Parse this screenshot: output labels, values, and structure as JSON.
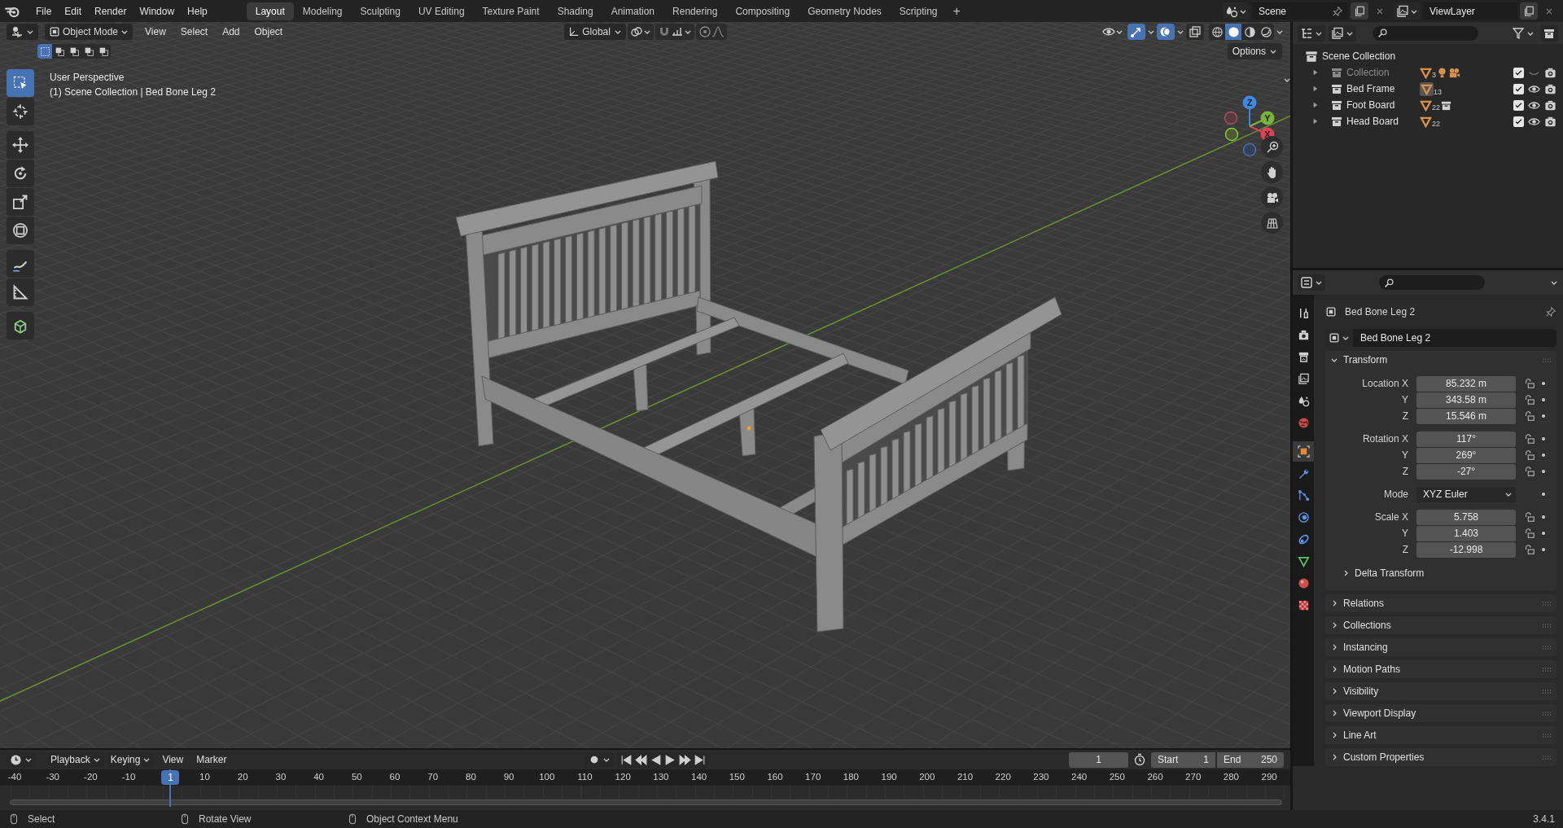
{
  "menu": [
    "File",
    "Edit",
    "Render",
    "Window",
    "Help"
  ],
  "workspaces": [
    {
      "label": "Layout",
      "selected": true
    },
    {
      "label": "Modeling",
      "selected": false
    },
    {
      "label": "Sculpting",
      "selected": false
    },
    {
      "label": "UV Editing",
      "selected": false
    },
    {
      "label": "Texture Paint",
      "selected": false
    },
    {
      "label": "Shading",
      "selected": false
    },
    {
      "label": "Animation",
      "selected": false
    },
    {
      "label": "Rendering",
      "selected": false
    },
    {
      "label": "Compositing",
      "selected": false
    },
    {
      "label": "Geometry Nodes",
      "selected": false
    },
    {
      "label": "Scripting",
      "selected": false
    }
  ],
  "add_workspace": "+",
  "scene": "Scene",
  "view_layer": "ViewLayer",
  "viewport": {
    "mode": "Object Mode",
    "menus": [
      "View",
      "Select",
      "Add",
      "Object"
    ],
    "orientation": "Global",
    "shading": [
      {
        "kind": "wireframe",
        "selected": false
      },
      {
        "kind": "solid",
        "selected": true
      },
      {
        "kind": "material",
        "selected": false
      },
      {
        "kind": "rendered",
        "selected": false
      }
    ],
    "options": "Options",
    "view_name": "User Perspective",
    "context": "(1) Scene Collection | Bed Bone Leg 2",
    "tools": [
      {
        "kind": "select",
        "selected": true
      },
      {
        "kind": "cursor",
        "selected": false
      },
      {
        "kind": "move",
        "selected": false
      },
      {
        "kind": "rotate",
        "selected": false
      },
      {
        "kind": "scale",
        "selected": false
      },
      {
        "kind": "transform",
        "selected": false
      },
      {
        "kind": "annotate",
        "selected": false
      },
      {
        "kind": "measure",
        "selected": false
      },
      {
        "kind": "add-cube",
        "selected": false
      }
    ],
    "axes": [
      "X",
      "Y",
      "Z"
    ]
  },
  "outliner": {
    "root": "Scene Collection",
    "items": [
      {
        "name": "Collection",
        "count": "3",
        "contents": [
          {
            "kind": "light"
          },
          {
            "kind": "camera"
          }
        ],
        "included": true,
        "visible": false,
        "active": false
      },
      {
        "name": "Bed Frame",
        "count": "13",
        "included": true,
        "visible": true,
        "active": true
      },
      {
        "name": "Foot Board",
        "count": "22",
        "contents": [
          {
            "kind": "collection"
          }
        ],
        "included": true,
        "visible": true,
        "active": false
      },
      {
        "name": "Head Board",
        "count": "22",
        "included": true,
        "visible": true,
        "active": false
      }
    ]
  },
  "properties": {
    "tabs": [
      {
        "kind": "tool",
        "selected": false
      },
      {
        "kind": "render",
        "selected": false
      },
      {
        "kind": "output",
        "selected": false
      },
      {
        "kind": "view-layer",
        "selected": false
      },
      {
        "kind": "scene",
        "selected": false
      },
      {
        "kind": "world",
        "selected": false
      },
      {
        "kind": "object",
        "selected": true
      },
      {
        "kind": "modifier",
        "selected": false
      },
      {
        "kind": "particles",
        "selected": false
      },
      {
        "kind": "physics",
        "selected": false
      },
      {
        "kind": "constraints",
        "selected": false
      },
      {
        "kind": "data",
        "selected": false
      },
      {
        "kind": "material",
        "selected": false
      },
      {
        "kind": "texture",
        "selected": false
      }
    ],
    "object": "Bed Bone Leg 2",
    "name": "Bed Bone Leg 2",
    "panels": [
      {
        "title": "Transform",
        "expanded": true,
        "groups": [
          [
            {
              "kind": "number",
              "label": "Location X",
              "value": "85.232 m"
            },
            {
              "kind": "number",
              "label": "Y",
              "value": "343.58 m"
            },
            {
              "kind": "number",
              "label": "Z",
              "value": "15.546 m"
            }
          ],
          [
            {
              "kind": "number",
              "label": "Rotation X",
              "value": "117°"
            },
            {
              "kind": "number",
              "label": "Y",
              "value": "269°"
            },
            {
              "kind": "number",
              "label": "Z",
              "value": "-27°"
            }
          ],
          [
            {
              "kind": "menu",
              "label": "Mode",
              "value": "XYZ Euler"
            }
          ],
          [
            {
              "kind": "number",
              "label": "Scale X",
              "value": "5.758"
            },
            {
              "kind": "number",
              "label": "Y",
              "value": "1.403"
            },
            {
              "kind": "number",
              "label": "Z",
              "value": "-12.998"
            }
          ]
        ],
        "subpanels": [
          {
            "title": "Delta Transform",
            "expanded": false
          }
        ]
      },
      {
        "title": "Relations",
        "expanded": false
      },
      {
        "title": "Collections",
        "expanded": false
      },
      {
        "title": "Instancing",
        "expanded": false
      },
      {
        "title": "Motion Paths",
        "expanded": false
      },
      {
        "title": "Visibility",
        "expanded": false
      },
      {
        "title": "Viewport Display",
        "expanded": false
      },
      {
        "title": "Line Art",
        "expanded": false
      },
      {
        "title": "Custom Properties",
        "expanded": false
      }
    ]
  },
  "timeline": {
    "menus": [
      "Playback",
      "Keying",
      "View",
      "Marker"
    ],
    "frame": "1",
    "start_label": "Start",
    "start": "1",
    "end_label": "End",
    "end": "250",
    "ticks": [
      "-40",
      "-30",
      "-20",
      "-10",
      "10",
      "20",
      "30",
      "40",
      "50",
      "60",
      "70",
      "80",
      "90",
      "100",
      "110",
      "120",
      "130",
      "140",
      "150",
      "160",
      "170",
      "180",
      "190",
      "200",
      "210",
      "220",
      "230",
      "240",
      "250",
      "260",
      "270",
      "280",
      "290"
    ],
    "playhead": "1"
  },
  "status_bar": {
    "hints": [
      "Select",
      "Rotate View",
      "Object Context Menu"
    ],
    "version": "3.4.1"
  }
}
